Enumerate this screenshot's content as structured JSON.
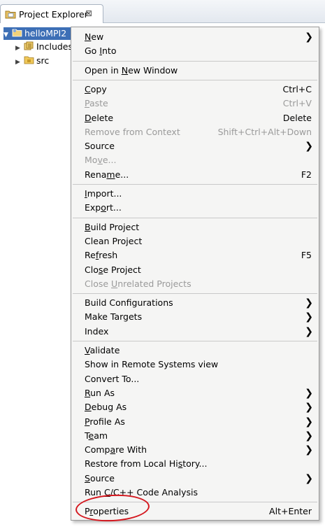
{
  "view": {
    "title": "Project Explorer",
    "close_glyph": "⊠",
    "icon": "project-explorer-icon"
  },
  "tree": [
    {
      "label": "helloMPI2",
      "icon": "project-folder-icon",
      "twisty": "▼",
      "selected": true
    },
    {
      "label": "Includes",
      "icon": "includes-icon",
      "twisty": "▶",
      "selected": false
    },
    {
      "label": "src",
      "icon": "source-folder-icon",
      "twisty": "▶",
      "selected": false
    }
  ],
  "menu": {
    "items": [
      {
        "label": "New",
        "mnemonic": 0,
        "accel": "",
        "submenu": true,
        "disabled": false
      },
      {
        "label": "Go Into",
        "mnemonic": 3,
        "accel": "",
        "submenu": false,
        "disabled": false
      },
      {
        "sep": true
      },
      {
        "label": "Open in New Window",
        "mnemonic": 8,
        "accel": "",
        "submenu": false,
        "disabled": false
      },
      {
        "sep": true
      },
      {
        "label": "Copy",
        "mnemonic": 0,
        "accel": "Ctrl+C",
        "submenu": false,
        "disabled": false
      },
      {
        "label": "Paste",
        "mnemonic": 0,
        "accel": "Ctrl+V",
        "submenu": false,
        "disabled": true
      },
      {
        "label": "Delete",
        "mnemonic": 0,
        "accel": "Delete",
        "submenu": false,
        "disabled": false
      },
      {
        "label": "Remove from Context",
        "mnemonic": -1,
        "accel": "Shift+Ctrl+Alt+Down",
        "submenu": false,
        "disabled": true
      },
      {
        "label": "Source",
        "mnemonic": -1,
        "accel": "",
        "submenu": true,
        "disabled": false
      },
      {
        "label": "Move...",
        "mnemonic": 2,
        "accel": "",
        "submenu": false,
        "disabled": true
      },
      {
        "label": "Rename...",
        "mnemonic": 4,
        "accel": "F2",
        "submenu": false,
        "disabled": false
      },
      {
        "sep": true
      },
      {
        "label": "Import...",
        "mnemonic": 0,
        "accel": "",
        "submenu": false,
        "disabled": false
      },
      {
        "label": "Export...",
        "mnemonic": 3,
        "accel": "",
        "submenu": false,
        "disabled": false
      },
      {
        "sep": true
      },
      {
        "label": "Build Project",
        "mnemonic": 0,
        "accel": "",
        "submenu": false,
        "disabled": false
      },
      {
        "label": "Clean Project",
        "mnemonic": -1,
        "accel": "",
        "submenu": false,
        "disabled": false
      },
      {
        "label": "Refresh",
        "mnemonic": 2,
        "accel": "F5",
        "submenu": false,
        "disabled": false
      },
      {
        "label": "Close Project",
        "mnemonic": 3,
        "accel": "",
        "submenu": false,
        "disabled": false
      },
      {
        "label": "Close Unrelated Projects",
        "mnemonic": 6,
        "accel": "",
        "submenu": false,
        "disabled": true
      },
      {
        "sep": true
      },
      {
        "label": "Build Configurations",
        "mnemonic": -1,
        "accel": "",
        "submenu": true,
        "disabled": false
      },
      {
        "label": "Make Targets",
        "mnemonic": -1,
        "accel": "",
        "submenu": true,
        "disabled": false
      },
      {
        "label": "Index",
        "mnemonic": -1,
        "accel": "",
        "submenu": true,
        "disabled": false
      },
      {
        "sep": true
      },
      {
        "label": "Validate",
        "mnemonic": 0,
        "accel": "",
        "submenu": false,
        "disabled": false
      },
      {
        "label": "Show in Remote Systems view",
        "mnemonic": -1,
        "accel": "",
        "submenu": false,
        "disabled": false
      },
      {
        "label": "Convert To...",
        "mnemonic": -1,
        "accel": "",
        "submenu": false,
        "disabled": false
      },
      {
        "label": "Run As",
        "mnemonic": 0,
        "accel": "",
        "submenu": true,
        "disabled": false
      },
      {
        "label": "Debug As",
        "mnemonic": 0,
        "accel": "",
        "submenu": true,
        "disabled": false
      },
      {
        "label": "Profile As",
        "mnemonic": 0,
        "accel": "",
        "submenu": true,
        "disabled": false
      },
      {
        "label": "Team",
        "mnemonic": 1,
        "accel": "",
        "submenu": true,
        "disabled": false
      },
      {
        "label": "Compare With",
        "mnemonic": 4,
        "accel": "",
        "submenu": true,
        "disabled": false
      },
      {
        "label": "Restore from Local History...",
        "mnemonic": 21,
        "accel": "",
        "submenu": false,
        "disabled": false
      },
      {
        "label": "Source",
        "mnemonic": 0,
        "accel": "",
        "submenu": true,
        "disabled": false
      },
      {
        "label": "Run C/C++ Code Analysis",
        "mnemonic": 4,
        "accel": "",
        "submenu": false,
        "disabled": false
      },
      {
        "sep": true
      },
      {
        "label": "Properties",
        "mnemonic": 1,
        "accel": "Alt+Enter",
        "submenu": false,
        "disabled": false
      }
    ],
    "submenu_glyph": "❯"
  },
  "highlight": {
    "target": "Properties",
    "color": "#d4181f"
  },
  "colors": {
    "selection": "#3d6fb6",
    "menu_bg": "#f5f5f4",
    "disabled": "#9a9a9a"
  }
}
